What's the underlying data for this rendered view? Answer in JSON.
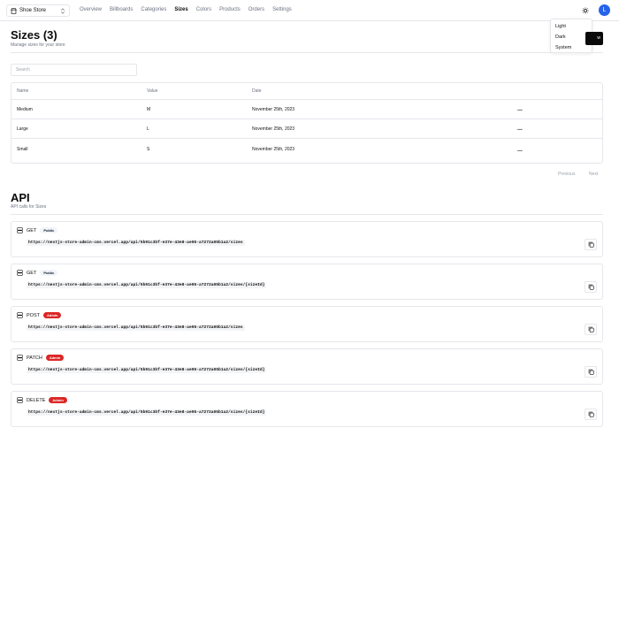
{
  "navbar": {
    "store_switcher": {
      "label": "Shoe Store"
    },
    "links": [
      {
        "label": "Overview",
        "active": false
      },
      {
        "label": "Billboards",
        "active": false
      },
      {
        "label": "Categories",
        "active": false
      },
      {
        "label": "Sizes",
        "active": true
      },
      {
        "label": "Colors",
        "active": false
      },
      {
        "label": "Products",
        "active": false
      },
      {
        "label": "Orders",
        "active": false
      },
      {
        "label": "Settings",
        "active": false
      }
    ],
    "theme_icon": "sun-icon",
    "avatar_initial": "L"
  },
  "theme_menu": {
    "items": [
      "Light",
      "Dark",
      "System"
    ]
  },
  "page": {
    "title": "Sizes (3)",
    "description": "Manage sizes for your store",
    "add_button_label": "w"
  },
  "search": {
    "placeholder": "Search",
    "value": ""
  },
  "table": {
    "headers": [
      "Name",
      "Value",
      "Date"
    ],
    "rows": [
      {
        "name": "Medium",
        "value": "M",
        "date": "November 25th, 2023",
        "actions": "..."
      },
      {
        "name": "Large",
        "value": "L",
        "date": "November 25th, 2023",
        "actions": "..."
      },
      {
        "name": "Small",
        "value": "S",
        "date": "November 25th, 2023",
        "actions": "..."
      }
    ]
  },
  "pagination": {
    "previous": "Previous",
    "next": "Next"
  },
  "api": {
    "title": "API",
    "description": "API calls for Sizes",
    "endpoints": [
      {
        "method": "GET",
        "badge": "Public",
        "url": "https://nextjs-store-admin-cms.vercel.app/api/5b91c3bf-e37e-43e8-ae95-a7272a05b1a2/sizes"
      },
      {
        "method": "GET",
        "badge": "Public",
        "url": "https://nextjs-store-admin-cms.vercel.app/api/5b91c3bf-e37e-43e8-ae95-a7272a05b1a2/sizes/{sizeId}"
      },
      {
        "method": "POST",
        "badge": "Admin",
        "url": "https://nextjs-store-admin-cms.vercel.app/api/5b91c3bf-e37e-43e8-ae95-a7272a05b1a2/sizes"
      },
      {
        "method": "PATCH",
        "badge": "Admin",
        "url": "https://nextjs-store-admin-cms.vercel.app/api/5b91c3bf-e37e-43e8-ae95-a7272a05b1a2/sizes/{sizeId}"
      },
      {
        "method": "DELETE",
        "badge": "Admin",
        "url": "https://nextjs-store-admin-cms.vercel.app/api/5b91c3bf-e37e-43e8-ae95-a7272a05b1a2/sizes/{sizeId}"
      }
    ]
  },
  "colors": {
    "accent": "#0a0a0a",
    "avatar": "#2563eb",
    "admin_badge": "#dc2626",
    "border": "#e5e7eb"
  }
}
